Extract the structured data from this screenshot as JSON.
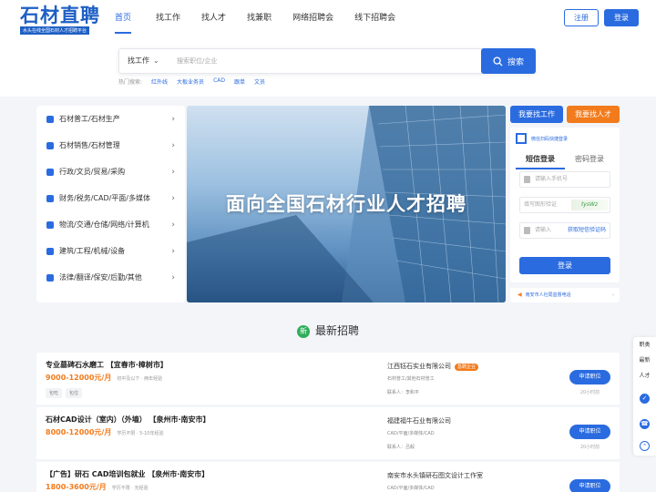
{
  "brand": {
    "name": "石材直聘",
    "slogan": "水头在线全国石材人才招聘平台"
  },
  "nav": [
    "首页",
    "找工作",
    "找人才",
    "找兼职",
    "网络招聘会",
    "线下招聘会"
  ],
  "auth": {
    "register": "注册",
    "login": "登录"
  },
  "search": {
    "type": "找工作",
    "placeholder": "搜索职位/企业",
    "button": "搜索"
  },
  "hot": {
    "label": "热门搜索:",
    "keywords": [
      "红外线",
      "大板业务员",
      "CAD",
      "跟单",
      "文员"
    ]
  },
  "categories": [
    "石材普工/石材生产",
    "石材销售/石材管理",
    "行政/文员/贸易/采购",
    "财务/税务/CAD/平面/多媒体",
    "物流/交通/仓储/网络/计算机",
    "建筑/工程/机械/设备",
    "法律/翻译/保安/后勤/其他"
  ],
  "banner": {
    "text": "面向全国石材行业人才招聘"
  },
  "login_card": {
    "seek_button": "我要找工作",
    "hire_button": "我要找人才",
    "qr_hint": "微信扫码快捷登录",
    "tabs": [
      "短信登录",
      "密码登录"
    ],
    "phone_placeholder": "请输入手机号",
    "captcha_placeholder": "填写图形验证",
    "captcha_text": "tysWz",
    "code_placeholder": "请输入",
    "get_code": "获取短信验证码",
    "submit": "登录"
  },
  "notice": "南安市人社局监督电话",
  "section_title": "最新招聘",
  "jobs": [
    {
      "title": "专业墓碑石水磨工 【宜春市·樟树市】",
      "salary": "9000-12000元/月",
      "req": "初中及以下 · 两年经验",
      "tags": [
        "包吃",
        "包住"
      ],
      "company": "江西钰石实业有限公司",
      "badge": "急聘企业",
      "industry": "石材普工/其他石材普工",
      "contact": "联系人：李和平",
      "apply": "申请职位",
      "time": "20小时前"
    },
    {
      "title": "石材CAD设计（室内）（外墙） 【泉州市·南安市】",
      "salary": "8000-12000元/月",
      "req": "学历不限 · 5-10年经验",
      "tags": [],
      "company": "福建福牛石业有限公司",
      "badge": "",
      "industry": "CAD/平面/多媒体/CAD",
      "contact": "联系人：吕毅",
      "apply": "申请职位",
      "time": "20小时前"
    },
    {
      "title": "【广告】研石 CAD培训包就业 【泉州市·南安市】",
      "salary": "1800-3600元/月",
      "req": "学历不限 · 无经验",
      "tags": [],
      "company": "南安市水头镇研石图文设计工作室",
      "badge": "",
      "industry": "CAD/平面/多媒体/CAD",
      "contact": "",
      "apply": "申请职位",
      "time": ""
    }
  ],
  "float_bar": {
    "items": [
      "职类",
      "最新",
      "人才"
    ]
  },
  "colors": {
    "primary": "#2a6be0",
    "accent": "#f27b1c",
    "badge_green": "#2fae5a"
  }
}
